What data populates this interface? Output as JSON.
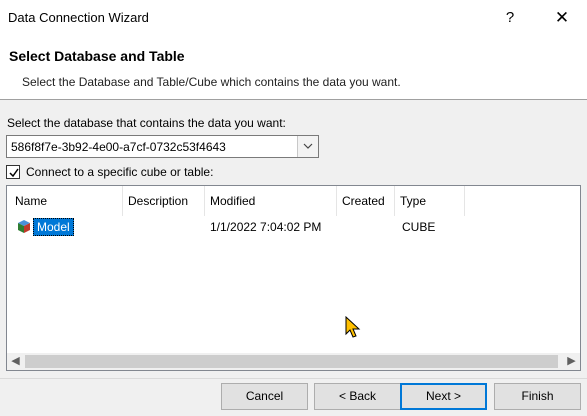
{
  "window": {
    "title": "Data Connection Wizard",
    "help_glyph": "?",
    "close_glyph": "✕"
  },
  "header": {
    "title": "Select Database and Table",
    "subtitle": "Select the Database and Table/Cube which contains the data you want."
  },
  "database": {
    "label": "Select the database that contains the data you want:",
    "value": "586f8f7e-3b92-4e00-a7cf-0732c53f4643"
  },
  "connect_checkbox": {
    "label": "Connect to a specific cube or table:",
    "checked": true
  },
  "table": {
    "columns": [
      "Name",
      "Description",
      "Modified",
      "Created",
      "Type"
    ],
    "rows": [
      {
        "icon": "cube-icon",
        "name": "Model",
        "description": "",
        "modified": "1/1/2022 7:04:02 PM",
        "created": "",
        "type": "CUBE",
        "selected": true
      }
    ]
  },
  "buttons": {
    "cancel": "Cancel",
    "back": "< Back",
    "next": "Next >",
    "finish": "Finish"
  },
  "colors": {
    "selection": "#0078d7",
    "cursor": "#ffc000"
  }
}
